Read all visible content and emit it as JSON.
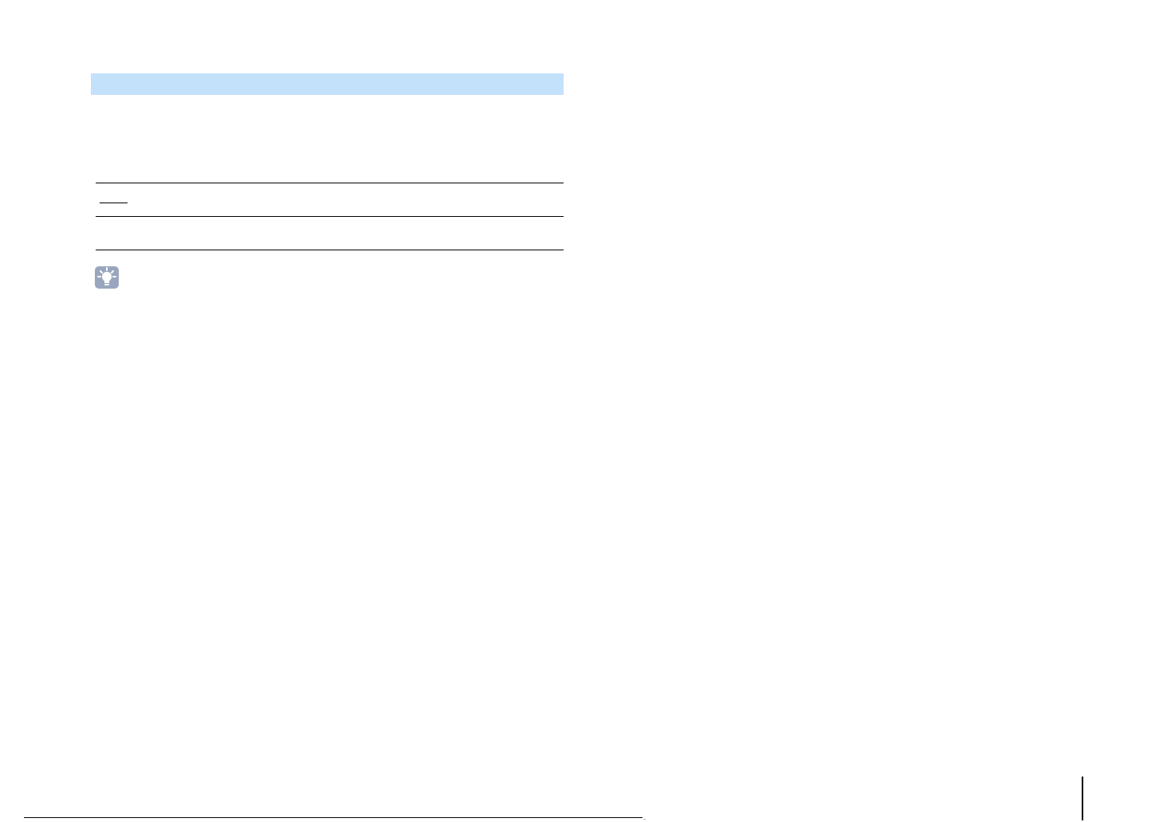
{
  "icons": {
    "hint": "lightbulb-icon"
  },
  "colors": {
    "section_bar": "#c4e1fc",
    "icon_background": "#9aa6be"
  },
  "footer": {
    "mark": ".."
  }
}
